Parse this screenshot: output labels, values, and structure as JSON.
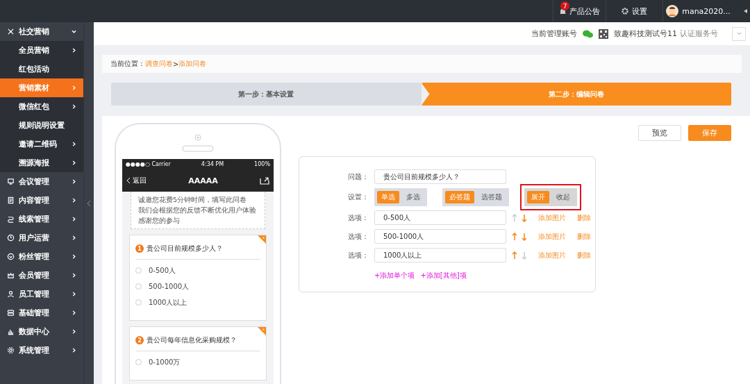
{
  "topbar": {
    "notice": {
      "badge": "7",
      "label": "产品公告"
    },
    "settings": "设置",
    "user": "mana2020..."
  },
  "sidebar": {
    "items": [
      {
        "kind": "group",
        "label": "社交营销",
        "expanded": true,
        "selected": false,
        "arrow": true,
        "children": [
          {
            "label": "全员营销",
            "selected": false,
            "arrow": true
          },
          {
            "label": "红包活动",
            "selected": false,
            "arrow": false
          },
          {
            "label": "营销素材",
            "selected": true,
            "arrow": true
          },
          {
            "label": "微信红包",
            "selected": false,
            "arrow": true
          },
          {
            "label": "规则说明设置",
            "selected": false,
            "arrow": false
          },
          {
            "label": "邀请二维码",
            "selected": false,
            "arrow": true
          },
          {
            "label": "溯源海报",
            "selected": false,
            "arrow": true
          }
        ]
      },
      {
        "kind": "group",
        "label": "会议管理",
        "expanded": false,
        "selected": false,
        "arrow": true
      },
      {
        "kind": "group",
        "label": "内容管理",
        "expanded": false,
        "selected": false,
        "arrow": true
      },
      {
        "kind": "group",
        "label": "线索管理",
        "expanded": false,
        "selected": false,
        "arrow": true
      },
      {
        "kind": "group",
        "label": "用户运营",
        "expanded": false,
        "selected": false,
        "arrow": true
      },
      {
        "kind": "group",
        "label": "粉丝管理",
        "expanded": false,
        "selected": false,
        "arrow": true
      },
      {
        "kind": "group",
        "label": "会员管理",
        "expanded": false,
        "selected": false,
        "arrow": true
      },
      {
        "kind": "group",
        "label": "员工管理",
        "expanded": false,
        "selected": false,
        "arrow": true
      },
      {
        "kind": "group",
        "label": "基础管理",
        "expanded": false,
        "selected": false,
        "arrow": true
      },
      {
        "kind": "group",
        "label": "数据中心",
        "expanded": false,
        "selected": false,
        "arrow": true
      },
      {
        "kind": "group",
        "label": "系统管理",
        "expanded": false,
        "selected": false,
        "arrow": true
      }
    ]
  },
  "account": {
    "label": "当前管理账号",
    "name": "致趣科技测试号11",
    "type": "认证服务号"
  },
  "breadcrumb": {
    "prefix": "当前位置：",
    "links": [
      "调查问卷",
      "添加问卷"
    ],
    "separator": ">"
  },
  "steps": [
    {
      "label": "第一步：基本设置",
      "selected": false
    },
    {
      "label": "第二步：编辑问卷",
      "selected": true
    }
  ],
  "actions": [
    {
      "label": "预览",
      "kind": "secondary"
    },
    {
      "label": "保存",
      "kind": "primary"
    }
  ],
  "phone": {
    "status": {
      "carrier": "●●●●○ Carrier",
      "time": "4:34 PM",
      "battery": "100%"
    },
    "back": "返回",
    "title": "AAAAA",
    "intro": [
      "诚邀您花费5分钟时间，填写此问卷",
      "我们会根据您的反馈不断优化用户体验",
      "感谢您的参与"
    ],
    "questions": [
      {
        "number": "1",
        "title": "贵公司目前规模多少人？",
        "required": true,
        "options": [
          {
            "label": "0-500人",
            "checked": false
          },
          {
            "label": "500-1000人",
            "checked": false
          },
          {
            "label": "1000人以上",
            "checked": false
          }
        ]
      },
      {
        "number": "2",
        "title": "贵公司每年信息化采购规模？",
        "required": true,
        "options": [
          {
            "label": "0-1000万",
            "checked": false
          }
        ]
      }
    ]
  },
  "editor": {
    "question_label": "问题：",
    "question": "贵公司目前规模多少人？",
    "settings_label": "设置：",
    "toggles": [
      {
        "highlighted": false,
        "options": [
          {
            "label": "单选",
            "selected": true
          },
          {
            "label": "多选",
            "selected": false
          }
        ]
      },
      {
        "highlighted": false,
        "options": [
          {
            "label": "必答题",
            "selected": true
          },
          {
            "label": "选答题",
            "selected": false
          }
        ]
      },
      {
        "highlighted": true,
        "options": [
          {
            "label": "展开",
            "selected": true
          },
          {
            "label": "收起",
            "selected": false
          }
        ]
      }
    ],
    "options": [
      {
        "label": "选项：",
        "value": "0-500人",
        "up_enabled": false,
        "down_enabled": true,
        "add_image": "添加图片",
        "delete": "删除"
      },
      {
        "label": "选项：",
        "value": "500-1000人",
        "up_enabled": true,
        "down_enabled": true,
        "add_image": "添加图片",
        "delete": "删除"
      },
      {
        "label": "选项：",
        "value": "1000人以上",
        "up_enabled": true,
        "down_enabled": false,
        "add_image": "添加图片",
        "delete": "删除"
      }
    ],
    "add_links": [
      "+添加单个项",
      "+添加[其他]项"
    ]
  }
}
